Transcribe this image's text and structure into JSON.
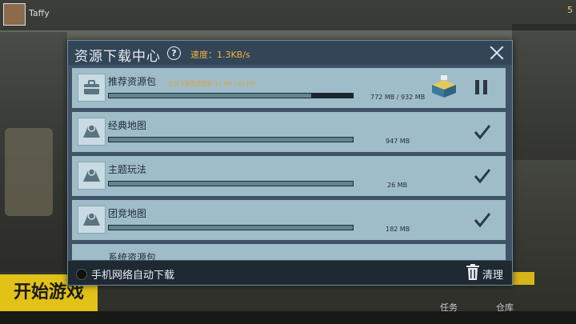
{
  "background": {
    "username": "Taffy",
    "start_button": "开始游戏",
    "bottom_tabs": [
      "任务",
      "仓库"
    ],
    "hud_right": "5"
  },
  "dialog": {
    "title": "资源下载中心",
    "speed": "速度：1.3KB/s",
    "items": [
      {
        "name": "推荐资源包",
        "status": "正在下载高清图标 15 MB / 82 MB",
        "size": "772 MB / 932 MB",
        "progress": 0.83,
        "state": "downloading",
        "icon": "briefcase-icon"
      },
      {
        "name": "经典地图",
        "status": "",
        "size": "947 MB",
        "progress": 1.0,
        "state": "done",
        "icon": "map-icon"
      },
      {
        "name": "主题玩法",
        "status": "",
        "size": "26 MB",
        "progress": 1.0,
        "state": "done",
        "icon": "map-icon"
      },
      {
        "name": "团竞地图",
        "status": "",
        "size": "182 MB",
        "progress": 1.0,
        "state": "done",
        "icon": "map-icon"
      },
      {
        "name": "系统资源包",
        "status": "",
        "size": "",
        "progress": 1.0,
        "state": "partial",
        "icon": "map-icon"
      }
    ],
    "footer": {
      "auto_download": "手机网络自动下载",
      "clear": "清理"
    }
  },
  "colors": {
    "accent": "#f0b33b",
    "dialog_bg": "#3f5266",
    "row_bg": "#9fbdc9"
  }
}
